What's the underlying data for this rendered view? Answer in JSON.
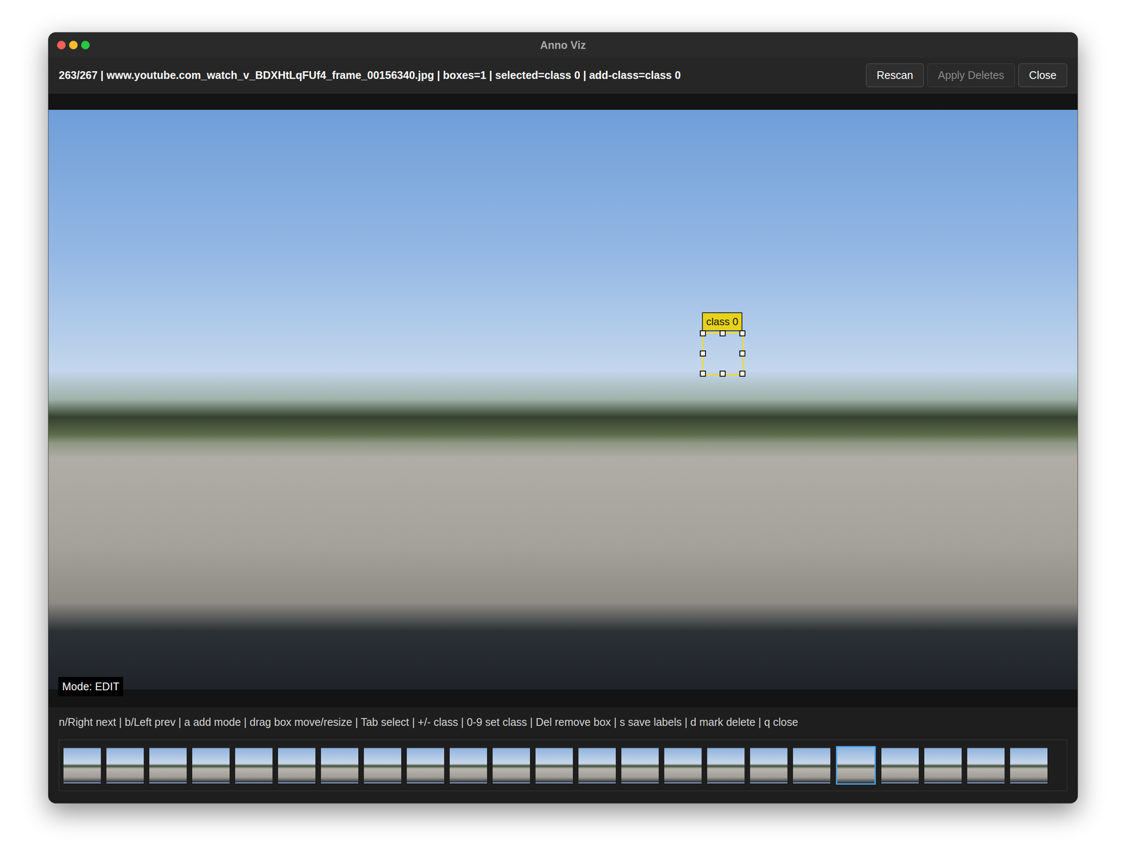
{
  "window": {
    "title": "Anno Viz",
    "controls": [
      {
        "color": "#fe5f57"
      },
      {
        "color": "#febc2e"
      },
      {
        "color": "#28c840"
      }
    ]
  },
  "toolbar": {
    "status": "263/267 | www.youtube.com_watch_v_BDXHtLqFUf4_frame_00156340.jpg | boxes=1 | selected=class 0 | add-class=class 0",
    "buttons": [
      {
        "label": "Rescan",
        "disabled": false
      },
      {
        "label": "Apply Deletes",
        "disabled": true
      },
      {
        "label": "Close",
        "disabled": false
      }
    ]
  },
  "viewer": {
    "mode": "Mode: EDIT",
    "boxes": [
      {
        "label": "class 0",
        "selected": true
      }
    ]
  },
  "hint": "n/Right next | b/Left prev | a add mode | drag box move/resize | Tab select | +/- class | 0-9 set class | Del remove box | s save labels | d mark delete | q close",
  "thumbnails": [
    {
      "selected": false
    },
    {
      "selected": false
    },
    {
      "selected": false
    },
    {
      "selected": false
    },
    {
      "selected": false
    },
    {
      "selected": false
    },
    {
      "selected": false
    },
    {
      "selected": false
    },
    {
      "selected": false
    },
    {
      "selected": false
    },
    {
      "selected": false
    },
    {
      "selected": false
    },
    {
      "selected": false
    },
    {
      "selected": false
    },
    {
      "selected": false
    },
    {
      "selected": false
    },
    {
      "selected": false
    },
    {
      "selected": false
    },
    {
      "selected": true
    },
    {
      "selected": false
    },
    {
      "selected": false
    },
    {
      "selected": false
    },
    {
      "selected": false
    }
  ]
}
